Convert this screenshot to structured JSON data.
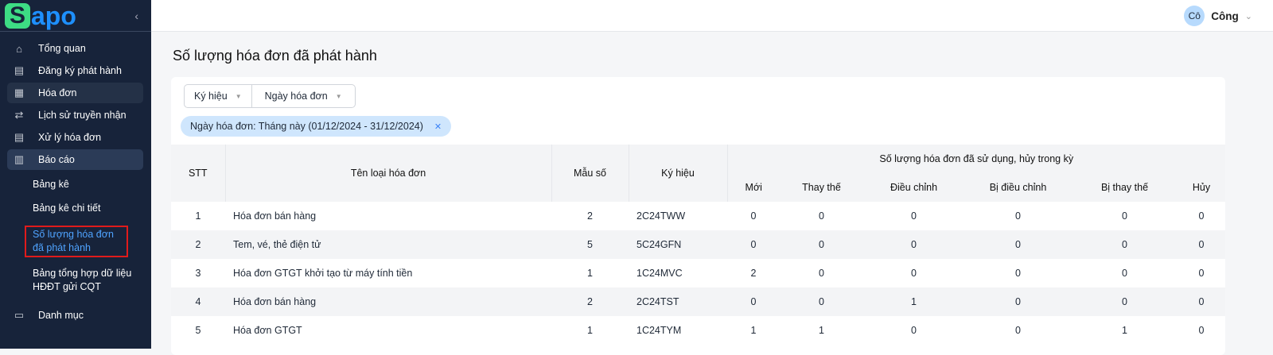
{
  "app": {
    "logo_s": "S",
    "logo_rest": "apo"
  },
  "sidebar": {
    "items": [
      {
        "label": "Tổng quan",
        "icon": "home-icon"
      },
      {
        "label": "Đăng ký phát hành",
        "icon": "register-icon"
      },
      {
        "label": "Hóa đơn",
        "icon": "document-icon"
      },
      {
        "label": "Lịch sử truyền nhận",
        "icon": "transfer-icon"
      },
      {
        "label": "Xử lý hóa đơn",
        "icon": "process-icon"
      },
      {
        "label": "Báo cáo",
        "icon": "chart-icon"
      }
    ],
    "report_sub": [
      "Bảng kê",
      "Bảng kê chi tiết",
      "Số lượng hóa đơn đã phát hành",
      "Bảng tổng hợp dữ liệu HĐĐT gửi CQT"
    ],
    "catalog": {
      "label": "Danh mục",
      "icon": "folder-icon"
    }
  },
  "header": {
    "avatar": "Cô",
    "user": "Công"
  },
  "page": {
    "title": "Số lượng hóa đơn đã phát hành",
    "filters": [
      "Ký hiệu",
      "Ngày hóa đơn"
    ],
    "chip": "Ngày hóa đơn: Tháng này (01/12/2024 - 31/12/2024)"
  },
  "table": {
    "headers": {
      "stt": "STT",
      "name": "Tên loại hóa đơn",
      "mau": "Mẫu số",
      "kh": "Ký hiệu",
      "group": "Số lượng hóa đơn đã sử dụng, hủy trong kỳ",
      "sub": [
        "Mới",
        "Thay thế",
        "Điều chỉnh",
        "Bị điều chỉnh",
        "Bị thay thế",
        "Hủy"
      ]
    },
    "rows": [
      [
        "1",
        "Hóa đơn bán hàng",
        "2",
        "2C24TWW",
        "0",
        "0",
        "0",
        "0",
        "0",
        "0"
      ],
      [
        "2",
        "Tem, vé, thẻ điện tử",
        "5",
        "5C24GFN",
        "0",
        "0",
        "0",
        "0",
        "0",
        "0"
      ],
      [
        "3",
        "Hóa đơn GTGT khởi tạo từ máy tính tiền",
        "1",
        "1C24MVC",
        "2",
        "0",
        "0",
        "0",
        "0",
        "0"
      ],
      [
        "4",
        "Hóa đơn bán hàng",
        "2",
        "2C24TST",
        "0",
        "0",
        "1",
        "0",
        "0",
        "0"
      ],
      [
        "5",
        "Hóa đơn GTGT",
        "1",
        "1C24TYM",
        "1",
        "1",
        "0",
        "0",
        "1",
        "0"
      ]
    ]
  }
}
